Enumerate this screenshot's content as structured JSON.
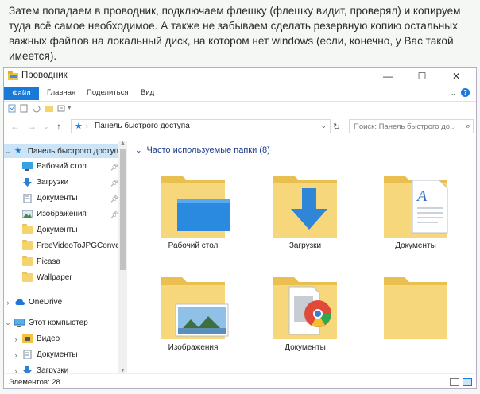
{
  "intro_text": "Затем попадаем в проводник, подключаем флешку (флешку видит, проверял) и копируем туда всё самое необходимое. А также не забываем сделать резервную копию остальных важных файлов на локальный диск, на котором нет windows (если, конечно, у Вас такой имеется).",
  "window": {
    "title": "Проводник",
    "controls": {
      "minimize": "—",
      "maximize": "☐",
      "close": "✕"
    }
  },
  "ribbon": {
    "tabs": [
      "Файл",
      "Главная",
      "Поделиться",
      "Вид"
    ],
    "help": "?"
  },
  "address": {
    "path": "Панель быстрого доступа",
    "search_placeholder": "Поиск: Панель быстрого до..."
  },
  "sidebar": {
    "quick_access": "Панель быстрого доступ",
    "pinned": [
      {
        "label": "Рабочий стол",
        "pinned": true
      },
      {
        "label": "Загрузки",
        "pinned": true
      },
      {
        "label": "Документы",
        "pinned": true
      },
      {
        "label": "Изображения",
        "pinned": true
      },
      {
        "label": "Документы",
        "pinned": false
      },
      {
        "label": "FreeVideoToJPGConver",
        "pinned": false
      },
      {
        "label": "Picasa",
        "pinned": false
      },
      {
        "label": "Wallpaper",
        "pinned": false
      }
    ],
    "onedrive": "OneDrive",
    "this_pc": "Этот компьютер",
    "pc_items": [
      "Видео",
      "Документы",
      "Загрузки"
    ]
  },
  "content": {
    "group_title": "Часто используемые папки (8)",
    "tiles": [
      "Рабочий стол",
      "Загрузки",
      "Документы",
      "Изображения",
      "Документы",
      ""
    ]
  },
  "status": {
    "count": "Элементов: 28"
  },
  "colors": {
    "accent": "#1a79d6",
    "folder": "#f5d470",
    "selected": "#cce4f7",
    "group_header": "#1e3d8f"
  }
}
